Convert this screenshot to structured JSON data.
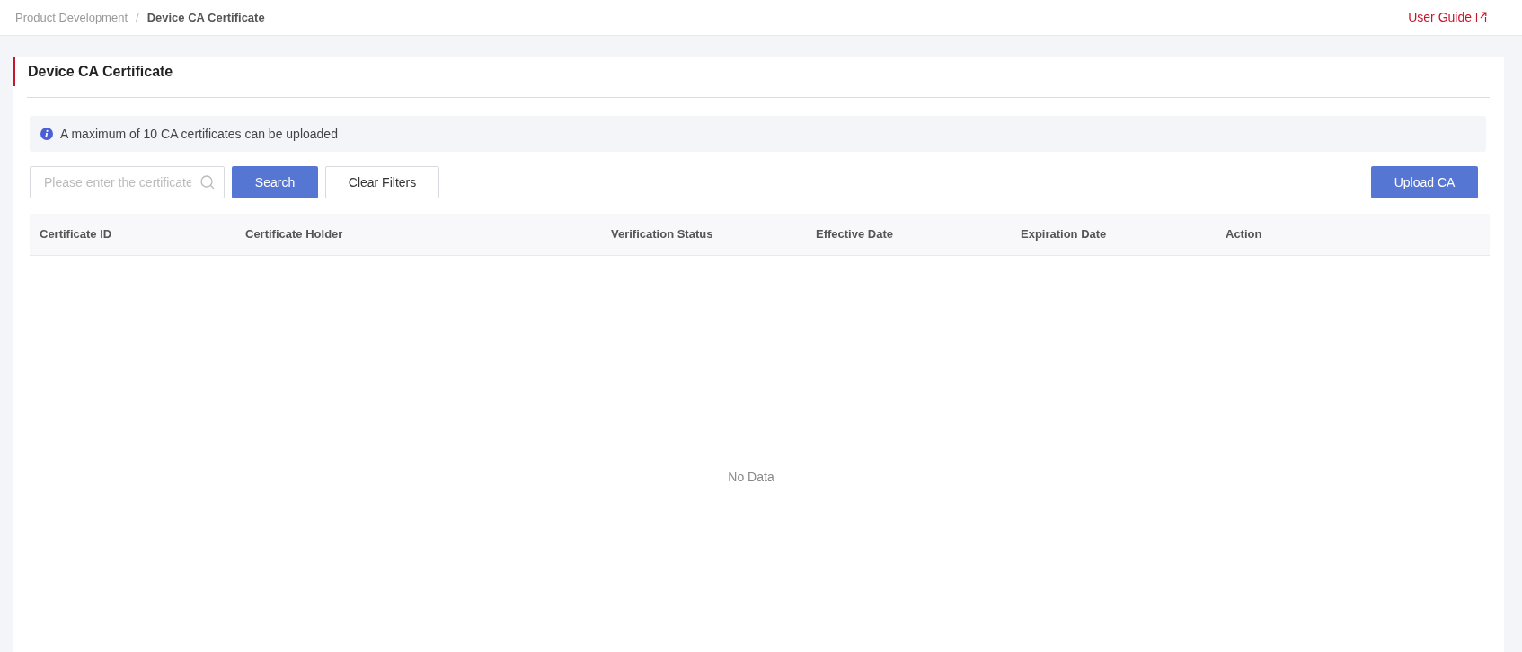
{
  "breadcrumb": [
    {
      "label": "Product Development",
      "current": false
    },
    {
      "label": "Device CA Certificate",
      "current": true
    }
  ],
  "breadcrumb_separator": "/",
  "user_guide": "User Guide",
  "title": "Device CA Certificate",
  "notice": "A maximum of 10 CA certificates can be uploaded",
  "search": {
    "placeholder": "Please enter the certificate"
  },
  "buttons": {
    "search": "Search",
    "clear": "Clear Filters",
    "upload": "Upload CA"
  },
  "table": {
    "columns": [
      "Certificate ID",
      "Certificate Holder",
      "Verification Status",
      "Effective Date",
      "Expiration Date",
      "Action"
    ],
    "empty_text": "No Data"
  }
}
